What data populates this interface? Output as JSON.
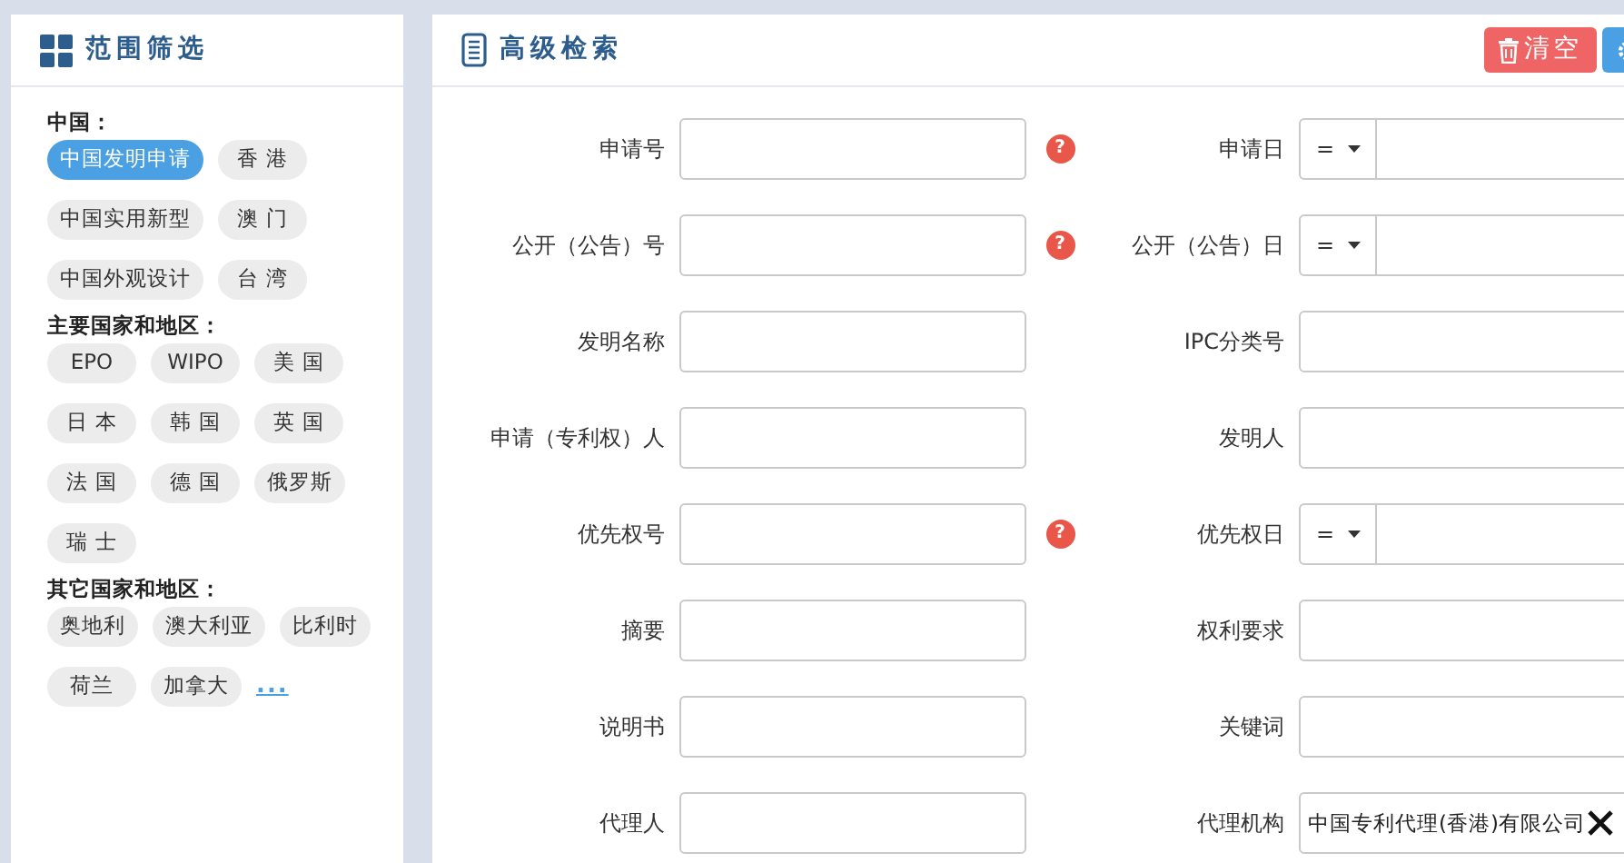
{
  "sidebar": {
    "title": "范围筛选",
    "groups": [
      {
        "title": "中国：",
        "chips": [
          {
            "label": "中国发明申请",
            "selected": true
          },
          {
            "label": "香 港",
            "selected": false
          },
          {
            "label": "中国实用新型",
            "selected": false
          },
          {
            "label": "澳 门",
            "selected": false
          },
          {
            "label": "中国外观设计",
            "selected": false
          },
          {
            "label": "台 湾",
            "selected": false
          }
        ]
      },
      {
        "title": "主要国家和地区：",
        "chips": [
          {
            "label": "EPO",
            "selected": false
          },
          {
            "label": "WIPO",
            "selected": false
          },
          {
            "label": "美 国",
            "selected": false
          },
          {
            "label": "日 本",
            "selected": false
          },
          {
            "label": "韩 国",
            "selected": false
          },
          {
            "label": "英 国",
            "selected": false
          },
          {
            "label": "法 国",
            "selected": false
          },
          {
            "label": "德 国",
            "selected": false
          },
          {
            "label": "俄罗斯",
            "selected": false
          },
          {
            "label": "瑞 士",
            "selected": false
          }
        ]
      },
      {
        "title": "其它国家和地区：",
        "chips": [
          {
            "label": "奥地利",
            "selected": false
          },
          {
            "label": "澳大利亚",
            "selected": false
          },
          {
            "label": "比利时",
            "selected": false
          },
          {
            "label": "荷兰",
            "selected": false
          },
          {
            "label": "加拿大",
            "selected": false
          }
        ],
        "more": "..."
      }
    ]
  },
  "main": {
    "title": "高级检索",
    "buttons": [
      {
        "kind": "danger",
        "label": "清空"
      },
      {
        "kind": "primary"
      }
    ],
    "rows": [
      {
        "left": {
          "label": "申请号",
          "help": "?"
        },
        "right": {
          "label": "申请日",
          "operator": "="
        }
      },
      {
        "left": {
          "label": "公开（公告）号",
          "help": "?"
        },
        "right": {
          "label": "公开（公告）日",
          "operator": "="
        }
      },
      {
        "left": {
          "label": "发明名称"
        },
        "right": {
          "label": "IPC分类号"
        }
      },
      {
        "left": {
          "label": "申请（专利权）人"
        },
        "right": {
          "label": "发明人"
        }
      },
      {
        "left": {
          "label": "优先权号",
          "help": "?"
        },
        "right": {
          "label": "优先权日",
          "operator": "="
        }
      },
      {
        "left": {
          "label": "摘要"
        },
        "right": {
          "label": "权利要求"
        }
      },
      {
        "left": {
          "label": "说明书"
        },
        "right": {
          "label": "关键词"
        }
      },
      {
        "left": {
          "label": "代理人"
        },
        "right": {
          "label": "代理机构",
          "value": "中国专利代理(香港)有限公司",
          "clearable": true
        }
      }
    ]
  }
}
